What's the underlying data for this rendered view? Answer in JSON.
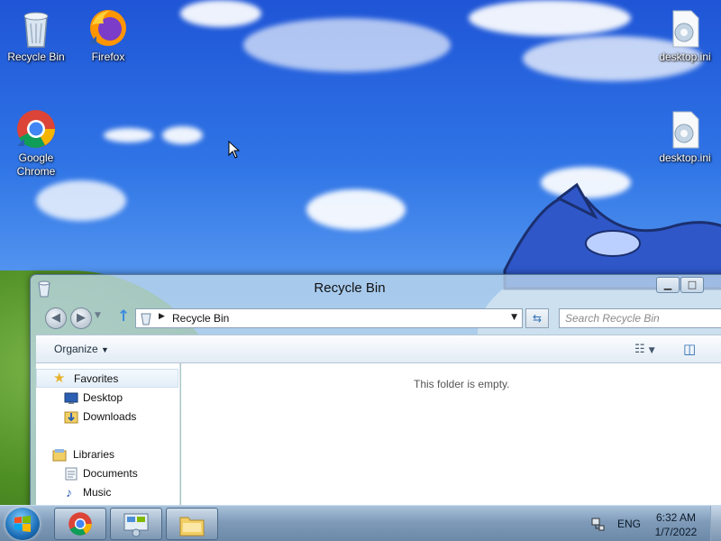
{
  "desktop": {
    "icons": [
      {
        "label": "Recycle Bin"
      },
      {
        "label": "Firefox"
      },
      {
        "label": "Google Chrome"
      },
      {
        "label": "desktop.ini"
      },
      {
        "label": "desktop.ini"
      }
    ]
  },
  "window": {
    "title": "Recycle Bin",
    "address_crumb": "Recycle Bin",
    "search_placeholder": "Search Recycle Bin",
    "organize_label": "Organize",
    "empty_message": "This folder is empty.",
    "nav": {
      "favorites_label": "Favorites",
      "favorites_items": [
        "Desktop",
        "Downloads"
      ],
      "libraries_label": "Libraries",
      "libraries_items": [
        "Documents",
        "Music"
      ]
    }
  },
  "taskbar": {
    "language": "ENG",
    "time": "6:32 AM",
    "date": "1/7/2022"
  },
  "colors": {
    "accent": "#2f6fb5",
    "taskbar": "#7f9bb9"
  }
}
